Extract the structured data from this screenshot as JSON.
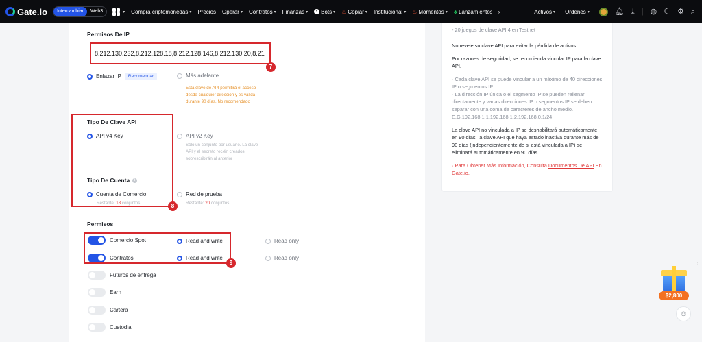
{
  "nav": {
    "logo": "Gate.io",
    "pill": [
      "Intercambiar",
      "Web3"
    ],
    "items": [
      {
        "label": "Compra criptomonedas",
        "caret": true
      },
      {
        "label": "Precios",
        "caret": false
      },
      {
        "label": "Operar",
        "caret": true
      },
      {
        "label": "Contratos",
        "caret": true
      },
      {
        "label": "Finanzas",
        "caret": true
      },
      {
        "label": "Bots",
        "caret": true
      },
      {
        "label": "Copiar",
        "caret": true
      },
      {
        "label": "Institucional",
        "caret": true
      },
      {
        "label": "Momentos",
        "caret": true
      },
      {
        "label": "Lanzamientos",
        "caret": false
      }
    ],
    "right": {
      "activos": "Activos",
      "ordenes": "Ordenes"
    }
  },
  "ip_section": {
    "title": "Permisos De IP",
    "ip_value": "8.212.130.232,8.212.128.18,8.212.128.146,8.212.130.20,8.21",
    "badge": "7",
    "option_bind": "Enlazar IP",
    "recommend_tag": "Recomendar",
    "option_later": "Más adelante",
    "later_note": [
      "Esta clave de API permitirá el acceso",
      "desde cualquier dirección y es válida",
      "durante 90 días. No recomendado"
    ]
  },
  "key_type": {
    "title": "Tipo De Clave API",
    "v4": "API v4 Key",
    "v2": "API v2 Key",
    "v2_note": [
      "Sólo un conjunto por usuario. La clave",
      "API y el secreto recién creados",
      "sobrescribirán al anterior"
    ]
  },
  "account_type": {
    "title": "Tipo De Cuenta",
    "trade": "Cuenta de Comercio",
    "trade_remaining_label": "Restante:",
    "trade_remaining_num": "18",
    "trade_remaining_unit": "conjuntos",
    "test": "Red de prueba",
    "test_remaining_label": "Restante:",
    "test_remaining_num": "20",
    "test_remaining_unit": "conjuntos",
    "badge": "8"
  },
  "permissions": {
    "title": "Permisos",
    "badge": "9",
    "rows": [
      {
        "label": "Comercio Spot",
        "on": true,
        "rw": "Read and write",
        "ro": "Read only"
      },
      {
        "label": "Contratos",
        "on": true,
        "rw": "Read and write",
        "ro": "Read only"
      },
      {
        "label": "Futuros de entrega",
        "on": false
      },
      {
        "label": "Earn",
        "on": false
      },
      {
        "label": "Cartera",
        "on": false
      },
      {
        "label": "Custodia",
        "on": false
      }
    ]
  },
  "aside": {
    "top_line": "- 20 juegos de clave API 4 en Testnet",
    "p1": "No revele su clave API para evitar la pérdida de activos.",
    "p2": "Por razones de seguridad, se recomienda vincular IP para la clave API.",
    "p3a": "· Cada clave API se puede vincular a un máximo de 40 direcciones IP o segmentos IP.",
    "p3b": "· La dirección IP única o el segmento IP se pueden rellenar directamente y varias direcciones IP o segmentos IP se deben separar con una coma de caracteres de ancho medio. E.G.192.168.1.1,192.168.1.2,192.168.0.1/24",
    "p4": "La clave API no vinculada a IP se deshabilitará automáticamente en 90 días; la clave API que haya estado inactiva durante más de 90 días (independientemente de si está vinculada a IP) se eliminará automáticamente en 90 días.",
    "p5_prefix": "· Para Obtener Más Información, Consulta ",
    "p5_link": "Documentos De API",
    "p5_suffix": " En Gate.io."
  },
  "gift": {
    "amount": "$2,800"
  }
}
